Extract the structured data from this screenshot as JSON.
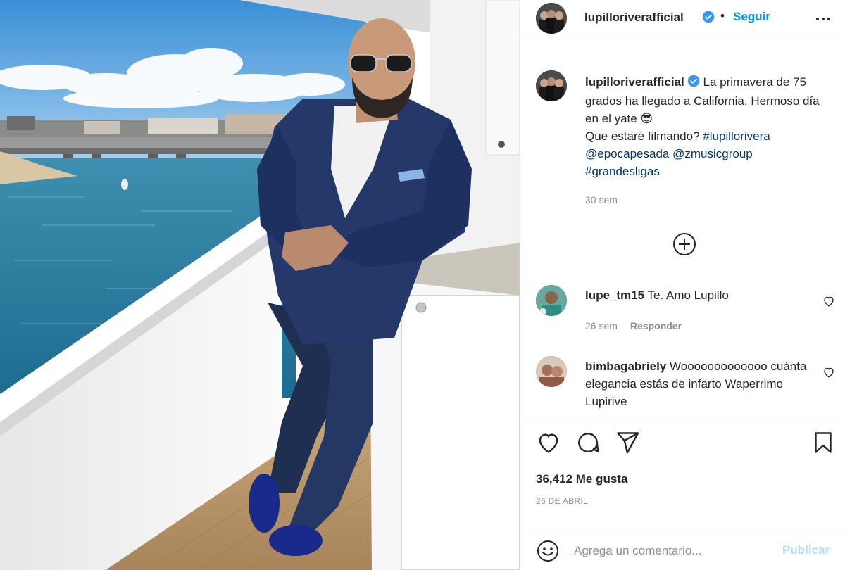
{
  "post": {
    "username": "lupilloriverafficial",
    "follow_label": "Seguir",
    "separator": "•",
    "caption": {
      "text_1": "La primavera de 75 grados ha llegado a California. Hermoso día en el yate ",
      "emoji": "😎",
      "text_2": "Que estaré filmando? ",
      "tags": [
        "#lupillorivera",
        "@epocapesada",
        "@zmusicgroup",
        "#grandesligas"
      ],
      "time": "30 sem"
    },
    "comments": [
      {
        "username": "lupe_tm15",
        "text": "Te. Amo Lupillo",
        "time": "26 sem",
        "reply_label": "Responder"
      },
      {
        "username": "bimbagabriely",
        "text": "Wooooooooooooo cuánta elegancia estás de infarto Waperrimo Lupirive"
      }
    ],
    "likes_text": "36,412 Me gusta",
    "date": "26 DE ABRIL",
    "comment_box": {
      "placeholder": "Agrega un comentario...",
      "post_label": "Publicar"
    }
  },
  "colors": {
    "link": "#0095f6",
    "hashtag": "#00376b",
    "secondary_text": "#8e8e8e",
    "post_disabled": "#b2dffc"
  },
  "icons": [
    "verified-badge-icon",
    "more-options-icon",
    "add-circle-icon",
    "heart-icon",
    "comment-icon",
    "share-icon",
    "bookmark-icon",
    "emoji-icon"
  ]
}
